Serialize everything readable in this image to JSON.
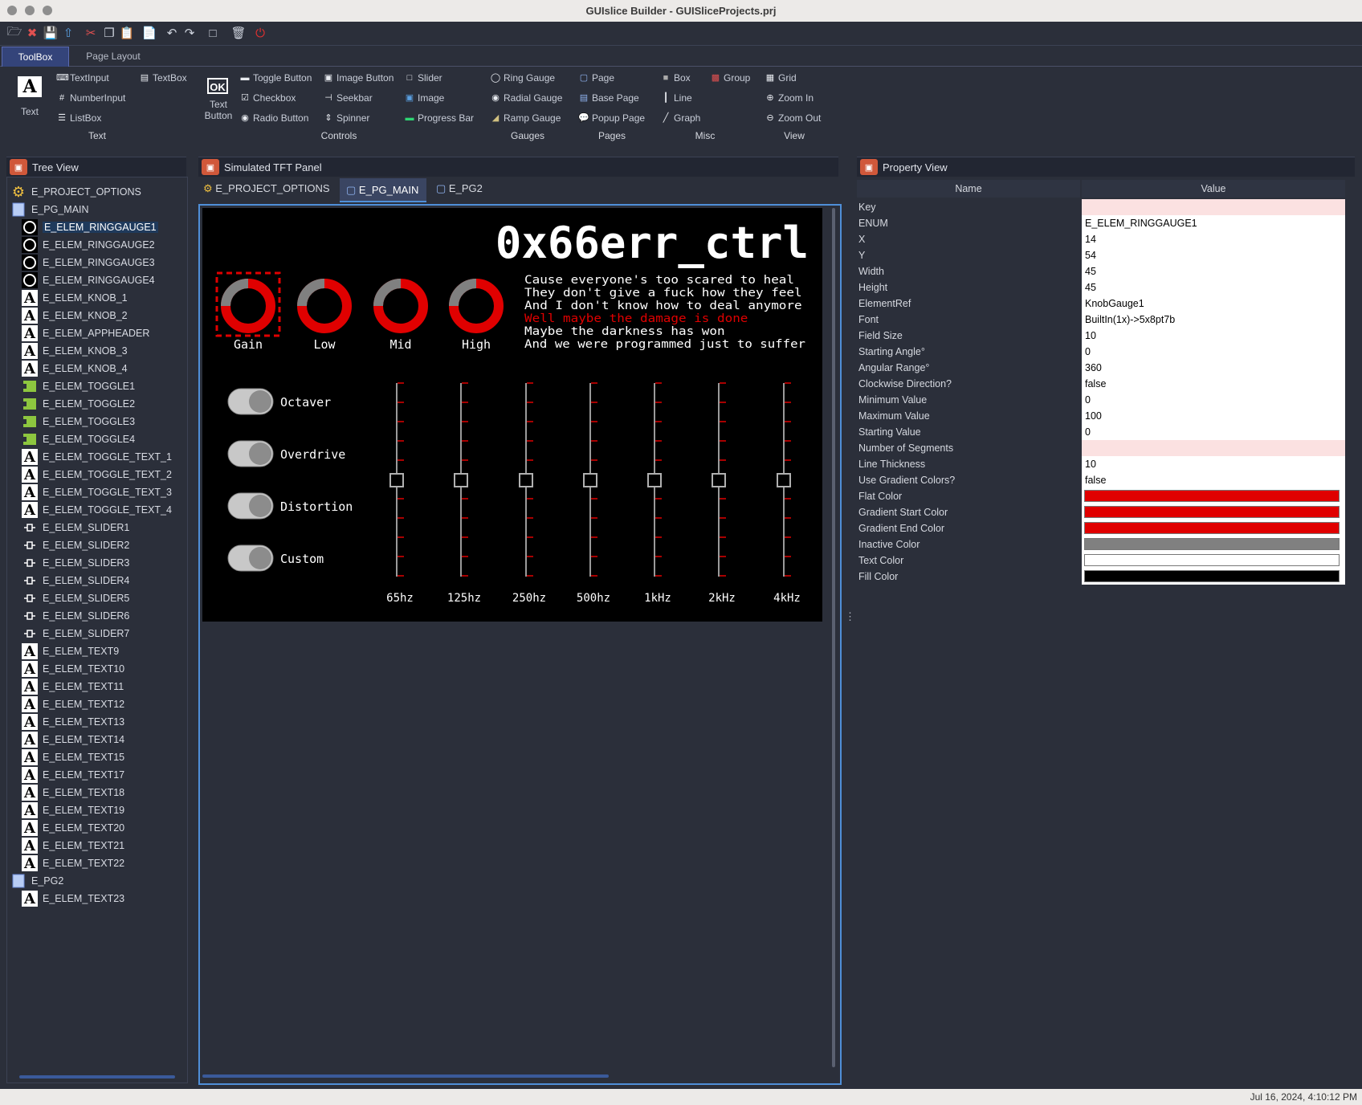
{
  "window": {
    "title": "GUIslice Builder - GUISliceProjects.prj"
  },
  "tabs": [
    {
      "label": "ToolBox",
      "active": true
    },
    {
      "label": "Page Layout",
      "active": false
    }
  ],
  "toolbox": {
    "text_big_label": "Text",
    "text_items": [
      "TextInput",
      "NumberInput",
      "ListBox",
      "TextBox"
    ],
    "text_group": "Text",
    "textbutton_label": "Text Button",
    "textbutton_icon": "OK",
    "controls_items": [
      "Toggle Button",
      "Checkbox",
      "Radio Button",
      "Image Button",
      "Seekbar",
      "Spinner",
      "Slider",
      "Image",
      "Progress Bar"
    ],
    "controls_group": "Controls",
    "gauges_items": [
      "Ring Gauge",
      "Radial Gauge",
      "Ramp Gauge"
    ],
    "gauges_group": "Gauges",
    "pages_items": [
      "Page",
      "Base Page",
      "Popup Page"
    ],
    "pages_group": "Pages",
    "misc_items": [
      "Box",
      "Line",
      "Graph",
      "Group"
    ],
    "misc_group": "Misc",
    "view_items": [
      "Grid",
      "Zoom In",
      "Zoom Out"
    ],
    "view_group": "View"
  },
  "panels": {
    "tree": "Tree View",
    "tft": "Simulated TFT Panel",
    "props": "Property View"
  },
  "center_tabs": [
    "E_PROJECT_OPTIONS",
    "E_PG_MAIN",
    "E_PG2"
  ],
  "tree": [
    {
      "label": "E_PROJECT_OPTIONS",
      "icon": "options"
    },
    {
      "label": "E_PG_MAIN",
      "icon": "page"
    },
    {
      "label": "E_ELEM_RINGGAUGE1",
      "icon": "ring",
      "selected": true
    },
    {
      "label": "E_ELEM_RINGGAUGE2",
      "icon": "ring"
    },
    {
      "label": "E_ELEM_RINGGAUGE3",
      "icon": "ring"
    },
    {
      "label": "E_ELEM_RINGGAUGE4",
      "icon": "ring"
    },
    {
      "label": "E_ELEM_KNOB_1",
      "icon": "text"
    },
    {
      "label": "E_ELEM_KNOB_2",
      "icon": "text"
    },
    {
      "label": "E_ELEM_APPHEADER",
      "icon": "text"
    },
    {
      "label": "E_ELEM_KNOB_3",
      "icon": "text"
    },
    {
      "label": "E_ELEM_KNOB_4",
      "icon": "text"
    },
    {
      "label": "E_ELEM_TOGGLE1",
      "icon": "toggle"
    },
    {
      "label": "E_ELEM_TOGGLE2",
      "icon": "toggle"
    },
    {
      "label": "E_ELEM_TOGGLE3",
      "icon": "toggle"
    },
    {
      "label": "E_ELEM_TOGGLE4",
      "icon": "toggle"
    },
    {
      "label": "E_ELEM_TOGGLE_TEXT_1",
      "icon": "text"
    },
    {
      "label": "E_ELEM_TOGGLE_TEXT_2",
      "icon": "text"
    },
    {
      "label": "E_ELEM_TOGGLE_TEXT_3",
      "icon": "text"
    },
    {
      "label": "E_ELEM_TOGGLE_TEXT_4",
      "icon": "text"
    },
    {
      "label": "E_ELEM_SLIDER1",
      "icon": "slider"
    },
    {
      "label": "E_ELEM_SLIDER2",
      "icon": "slider"
    },
    {
      "label": "E_ELEM_SLIDER3",
      "icon": "slider"
    },
    {
      "label": "E_ELEM_SLIDER4",
      "icon": "slider"
    },
    {
      "label": "E_ELEM_SLIDER5",
      "icon": "slider"
    },
    {
      "label": "E_ELEM_SLIDER6",
      "icon": "slider"
    },
    {
      "label": "E_ELEM_SLIDER7",
      "icon": "slider"
    },
    {
      "label": "E_ELEM_TEXT9",
      "icon": "text"
    },
    {
      "label": "E_ELEM_TEXT10",
      "icon": "text"
    },
    {
      "label": "E_ELEM_TEXT11",
      "icon": "text"
    },
    {
      "label": "E_ELEM_TEXT12",
      "icon": "text"
    },
    {
      "label": "E_ELEM_TEXT13",
      "icon": "text"
    },
    {
      "label": "E_ELEM_TEXT14",
      "icon": "text"
    },
    {
      "label": "E_ELEM_TEXT15",
      "icon": "text"
    },
    {
      "label": "E_ELEM_TEXT17",
      "icon": "text"
    },
    {
      "label": "E_ELEM_TEXT18",
      "icon": "text"
    },
    {
      "label": "E_ELEM_TEXT19",
      "icon": "text"
    },
    {
      "label": "E_ELEM_TEXT20",
      "icon": "text"
    },
    {
      "label": "E_ELEM_TEXT21",
      "icon": "text"
    },
    {
      "label": "E_ELEM_TEXT22",
      "icon": "text"
    },
    {
      "label": "E_PG2",
      "icon": "page"
    },
    {
      "label": "E_ELEM_TEXT23",
      "icon": "text"
    }
  ],
  "tft": {
    "header": "0x66err_ctrl",
    "knobs": [
      "Gain",
      "Low",
      "Mid",
      "High"
    ],
    "lyrics": [
      {
        "text": "Cause everyone's too scared to heal",
        "color": "#ffffff"
      },
      {
        "text": "They don't give a fuck how they feel",
        "color": "#ffffff"
      },
      {
        "text": "And I don't know how to deal anymore",
        "color": "#ffffff"
      },
      {
        "text": "Well maybe the damage is done",
        "color": "#e00000"
      },
      {
        "text": "Maybe the darkness has won",
        "color": "#ffffff"
      },
      {
        "text": "And we were programmed just to suffer",
        "color": "#ffffff"
      }
    ],
    "toggles": [
      "Octaver",
      "Overdrive",
      "Distortion",
      "Custom"
    ],
    "bands": [
      "65hz",
      "125hz",
      "250hz",
      "500hz",
      "1kHz",
      "2kHz",
      "4kHz"
    ]
  },
  "properties": {
    "header_name": "Name",
    "header_value": "Value",
    "rows": [
      {
        "name": "Key",
        "value": "",
        "style": "pink"
      },
      {
        "name": "ENUM",
        "value": "E_ELEM_RINGGAUGE1"
      },
      {
        "name": "X",
        "value": "14"
      },
      {
        "name": "Y",
        "value": "54"
      },
      {
        "name": "Width",
        "value": "45"
      },
      {
        "name": "Height",
        "value": "45"
      },
      {
        "name": "ElementRef",
        "value": "KnobGauge1"
      },
      {
        "name": "Font",
        "value": "BuiltIn(1x)->5x8pt7b"
      },
      {
        "name": "Field Size",
        "value": "10"
      },
      {
        "name": "Starting Angle°",
        "value": "0"
      },
      {
        "name": "Angular Range°",
        "value": "360"
      },
      {
        "name": "Clockwise Direction?",
        "value": "false"
      },
      {
        "name": "Minimum Value",
        "value": "0"
      },
      {
        "name": "Maximum Value",
        "value": "100"
      },
      {
        "name": "Starting Value",
        "value": "0"
      },
      {
        "name": "Number of Segments",
        "value": "",
        "style": "pink"
      },
      {
        "name": "Line Thickness",
        "value": "10"
      },
      {
        "name": "Use Gradient Colors?",
        "value": "false"
      },
      {
        "name": "Flat Color",
        "value": "",
        "color": "#e00000"
      },
      {
        "name": "Gradient Start Color",
        "value": "",
        "color": "#e00000"
      },
      {
        "name": "Gradient End Color",
        "value": "",
        "color": "#e00000"
      },
      {
        "name": "Inactive Color",
        "value": "",
        "color": "#808080"
      },
      {
        "name": "Text Color",
        "value": "",
        "color": "#ffffff"
      },
      {
        "name": "Fill Color",
        "value": "",
        "color": "#000000"
      }
    ]
  },
  "status": {
    "timestamp": "Jul 16, 2024, 4:10:12 PM"
  },
  "colors": {
    "accent": "#4f8fd8",
    "tft_red": "#e00000",
    "tft_gray": "#808080"
  }
}
